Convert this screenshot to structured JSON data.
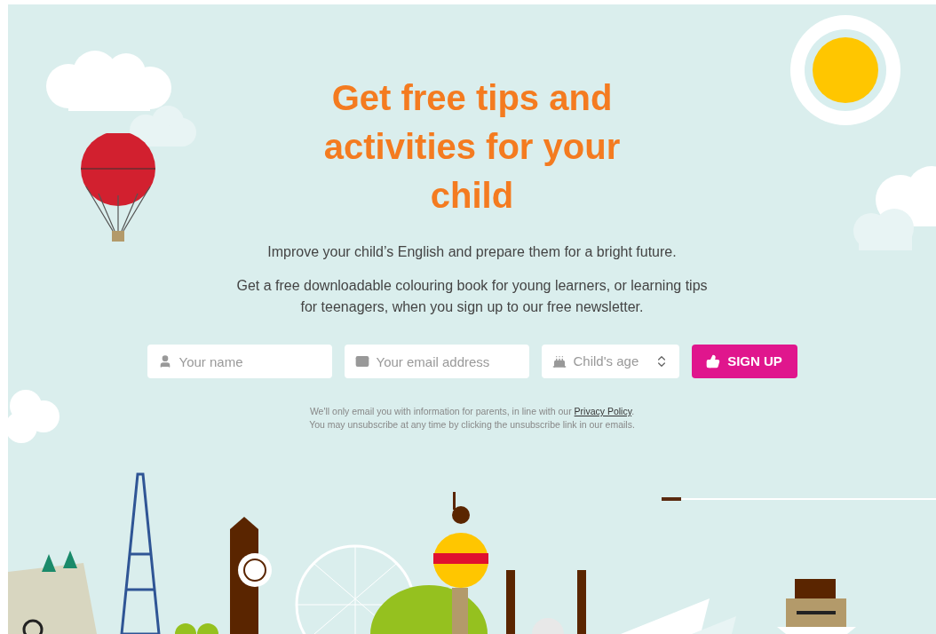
{
  "heading": "Get free tips and activities for your child",
  "intro": "Improve your child’s English and prepare them for a bright future.",
  "description": "Get a free downloadable colouring book for young learners, or learning tips for teenagers, when you sign up to our free newsletter.",
  "form": {
    "fields": [
      {
        "kind": "name",
        "placeholder": "Your name"
      },
      {
        "kind": "email",
        "placeholder": "Your email address"
      },
      {
        "kind": "select",
        "placeholder": "Child's age"
      }
    ],
    "button": "SIGN UP"
  },
  "disclaimer": {
    "before_link": "We'll only email you with information for parents, in line with our",
    "link": "Privacy Policy",
    "after_link": ".",
    "second_line": "You may unsubscribe at any time by clicking the unsubscribe link in our emails."
  }
}
